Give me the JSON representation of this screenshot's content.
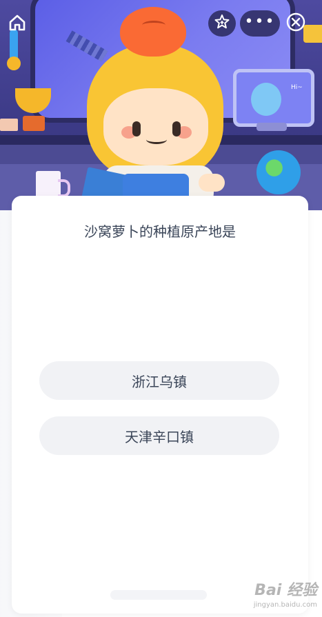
{
  "header": {
    "home_icon": "home-icon",
    "star_icon": "star-plus-icon",
    "more_icon": "more-dots-icon",
    "more_label": "•••",
    "close_icon": "close-circle-icon",
    "illustration_text": "Hi~"
  },
  "quiz": {
    "question": "沙窝萝卜的种植原产地是",
    "options": [
      {
        "label": "浙江乌镇"
      },
      {
        "label": "天津辛口镇"
      }
    ]
  },
  "watermark": {
    "logo": "Bai 经验",
    "sub": "jingyan.baidu.com"
  },
  "colors": {
    "hero_bg": "#3c3a86",
    "card_bg": "#ffffff",
    "option_bg": "#f1f2f5",
    "text": "#3a4558"
  }
}
